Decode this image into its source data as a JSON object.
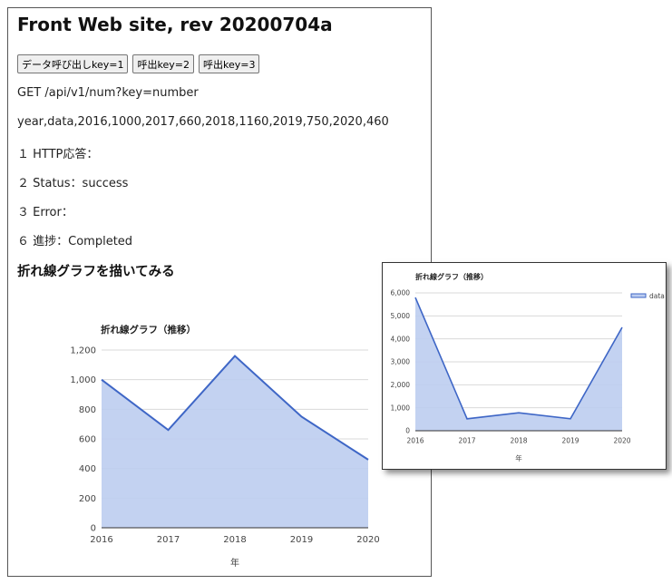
{
  "header": {
    "title": "Front Web site, rev 20200704a"
  },
  "buttons": [
    {
      "label": "データ呼び出しkey=1"
    },
    {
      "label": "呼出key=2"
    },
    {
      "label": "呼出key=3"
    }
  ],
  "output": {
    "request": "GET /api/v1/num?key=number",
    "response_data": "year,data,2016,1000,2017,660,2018,1160,2019,750,2020,460",
    "http_response": "１ HTTP応答：",
    "status": "２ Status：success",
    "error": "３ Error：",
    "progress": "６ 進捗：Completed"
  },
  "section": {
    "heading": "折れ線グラフを描いてみる"
  },
  "colors": {
    "line": "#3e66c6",
    "fill": "#bccdf0",
    "grid": "#d9d9d9",
    "axis": "#333333"
  },
  "chart_data": [
    {
      "type": "area",
      "title": "折れ線グラフ（推移）",
      "xlabel": "年",
      "ylabel": "",
      "x": [
        "2016",
        "2017",
        "2018",
        "2019",
        "2020"
      ],
      "series": [
        {
          "values": [
            1000,
            660,
            1160,
            750,
            460
          ]
        }
      ],
      "ylim": [
        0,
        1200
      ],
      "yticks": [
        0,
        200,
        400,
        600,
        800,
        1000,
        1200
      ],
      "ytick_labels": [
        "0",
        "200",
        "400",
        "600",
        "800",
        "1,000",
        "1,200"
      ],
      "grid": true
    },
    {
      "type": "area",
      "title": "折れ線グラフ（推移）",
      "xlabel": "年",
      "ylabel": "",
      "x": [
        "2016",
        "2017",
        "2018",
        "2019",
        "2020"
      ],
      "series": [
        {
          "name": "data",
          "values": [
            5800,
            520,
            780,
            520,
            4500
          ]
        }
      ],
      "ylim": [
        0,
        6000
      ],
      "yticks": [
        0,
        1000,
        2000,
        3000,
        4000,
        5000,
        6000
      ],
      "ytick_labels": [
        "0",
        "1,000",
        "2,000",
        "3,000",
        "4,000",
        "5,000",
        "6,000"
      ],
      "grid": true,
      "legend": "right"
    }
  ]
}
